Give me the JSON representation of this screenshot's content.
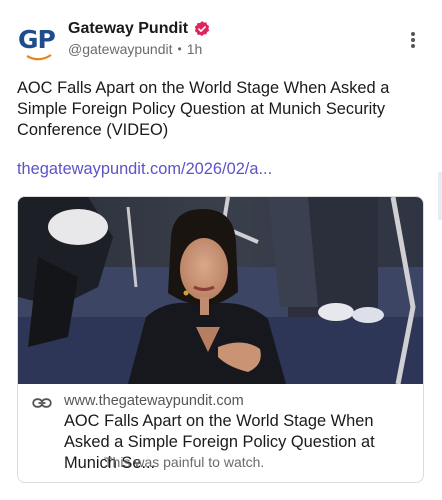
{
  "author": {
    "avatar_text": "GP",
    "display_name": "Gateway Pundit",
    "handle": "@gatewaypundit",
    "separator": "•",
    "time": "1h"
  },
  "post": {
    "text": "AOC Falls Apart on the World Stage When Asked a Simple Foreign Policy Question at Munich Security Conference (VIDEO)",
    "link_text": "thegatewaypundit.com/2026/02/a..."
  },
  "card": {
    "domain": "www.thegatewaypundit.com",
    "title": "AOC Falls Apart on the World Stage When Asked a Simple Foreign Policy Question at Munich Se...",
    "description": "This was painful to watch."
  },
  "colors": {
    "link": "#5a54c8",
    "verified_badge": "#e0245e",
    "avatar_brand": "#1f4d8c",
    "avatar_accent": "#e08a1e"
  },
  "icons": {
    "verified": "verified-badge-icon",
    "more": "more-vertical-icon",
    "link": "link-icon"
  }
}
